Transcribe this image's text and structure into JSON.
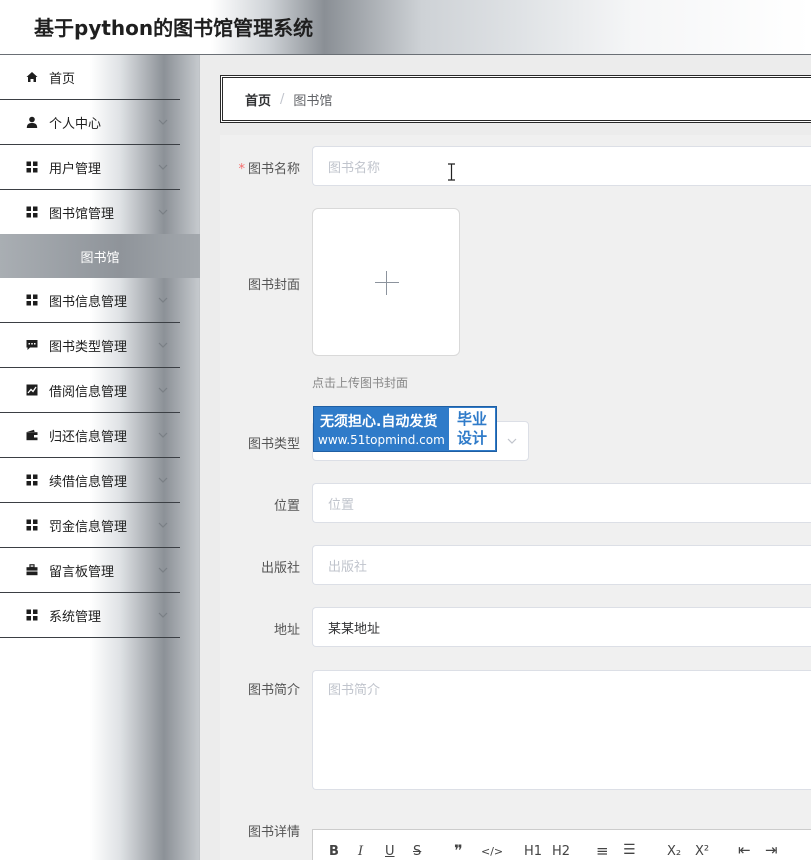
{
  "app": {
    "title": "基于python的图书馆管理系统"
  },
  "sidebar": {
    "items": [
      {
        "label": "首页",
        "icon": "home-icon"
      },
      {
        "label": "个人中心",
        "icon": "user-icon"
      },
      {
        "label": "用户管理",
        "icon": "grid-icon"
      },
      {
        "label": "图书馆管理",
        "icon": "grid-icon"
      },
      {
        "label": "图书信息管理",
        "icon": "grid-icon"
      },
      {
        "label": "图书类型管理",
        "icon": "message-icon"
      },
      {
        "label": "借阅信息管理",
        "icon": "chart-icon"
      },
      {
        "label": "归还信息管理",
        "icon": "wallet-icon"
      },
      {
        "label": "续借信息管理",
        "icon": "grid-icon"
      },
      {
        "label": "罚金信息管理",
        "icon": "grid-icon"
      },
      {
        "label": "留言板管理",
        "icon": "briefcase-icon"
      },
      {
        "label": "系统管理",
        "icon": "grid-icon"
      }
    ],
    "active_sub": {
      "label": "图书馆"
    }
  },
  "breadcrumb": {
    "home": "首页",
    "separator": "/",
    "current": "图书馆"
  },
  "form": {
    "name": {
      "label": "图书名称",
      "placeholder": "图书名称",
      "required_mark": "*"
    },
    "cover": {
      "label": "图书封面",
      "tip": "点击上传图书封面"
    },
    "type": {
      "label": "图书类型"
    },
    "location": {
      "label": "位置",
      "placeholder": "位置"
    },
    "publisher": {
      "label": "出版社",
      "placeholder": "出版社"
    },
    "address": {
      "label": "地址",
      "value": "某某地址"
    },
    "intro": {
      "label": "图书简介",
      "placeholder": "图书简介"
    },
    "details": {
      "label": "图书详情"
    }
  },
  "watermark": {
    "line1": "无须担心.自动发货",
    "line2": "www.51topmind.com",
    "box_line1": "毕业",
    "box_line2": "设计"
  },
  "editor_toolbar": {
    "bold": "B",
    "italic": "I",
    "underline": "U",
    "strike": "S",
    "blockquote": "❞",
    "code": "</>",
    "h1": "H1",
    "h2": "H2",
    "ordered_list": "≡",
    "bullet_list": "☰",
    "subscript": "X₂",
    "superscript": "X²",
    "outdent": "⇤",
    "indent": "⇥"
  },
  "colors": {
    "required": "#f56c6c",
    "border": "#dcdfe6",
    "placeholder": "#c0c4cc",
    "watermark_blue": "#2f7bc9",
    "active_sub_bg": "#8f949a"
  }
}
